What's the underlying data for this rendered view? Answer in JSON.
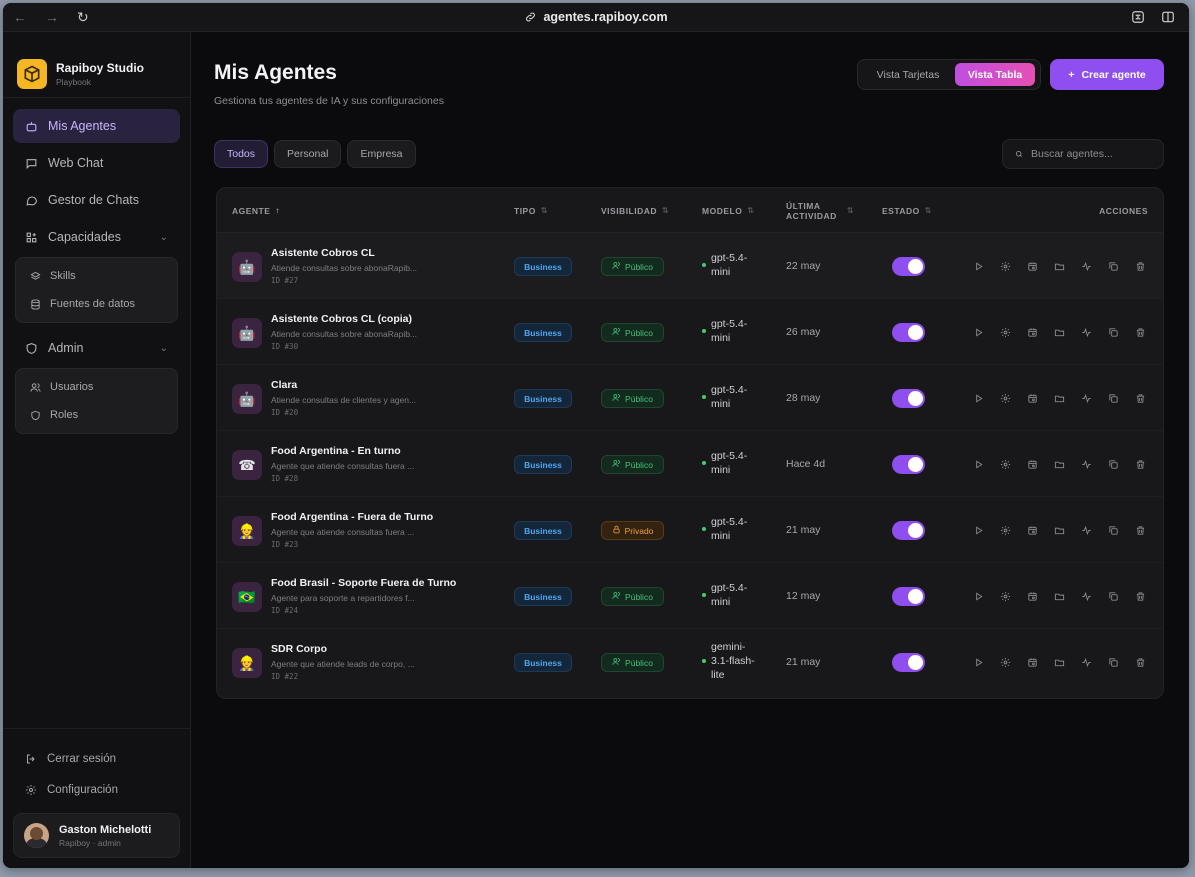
{
  "browser": {
    "url": "agentes.rapiboy.com"
  },
  "brand": {
    "name": "Rapiboy Studio",
    "subtitle": "Playbook"
  },
  "sidebar": {
    "items": [
      {
        "label": "Mis Agentes",
        "icon": "bot-icon",
        "active": true
      },
      {
        "label": "Web Chat",
        "icon": "message-square-icon"
      },
      {
        "label": "Gestor de Chats",
        "icon": "message-circle-icon"
      },
      {
        "label": "Capacidades",
        "icon": "grid-plus-icon",
        "sub": [
          {
            "label": "Skills",
            "icon": "layers-icon"
          },
          {
            "label": "Fuentes de datos",
            "icon": "database-icon"
          }
        ]
      },
      {
        "label": "Admin",
        "icon": "shield-icon",
        "sub": [
          {
            "label": "Usuarios",
            "icon": "users-icon"
          },
          {
            "label": "Roles",
            "icon": "shield-icon"
          }
        ]
      }
    ],
    "bottom": [
      {
        "label": "Cerrar sesión",
        "icon": "logout-icon"
      },
      {
        "label": "Configuración",
        "icon": "gear-icon"
      }
    ],
    "user": {
      "name": "Gaston Michelotti",
      "role": "Rapiboy · admin"
    }
  },
  "header": {
    "title": "Mis Agentes",
    "subtitle": "Gestiona tus agentes de IA y sus configuraciones",
    "view_cards": "Vista Tarjetas",
    "view_table": "Vista Tabla",
    "create": "Crear agente"
  },
  "filters": {
    "items": [
      "Todos",
      "Personal",
      "Empresa"
    ],
    "active": "Todos"
  },
  "search": {
    "placeholder": "Buscar agentes..."
  },
  "table": {
    "columns": {
      "agent": "Agente",
      "type": "Tipo",
      "visibility": "Visibilidad",
      "model": "Modelo",
      "activity": "Última actividad",
      "status": "Estado",
      "actions": "Acciones"
    },
    "rows": [
      {
        "icon": "🤖",
        "name": "Asistente Cobros CL",
        "desc": "Atiende consultas sobre abonaRapib...",
        "id": "ID #27",
        "type": "Business",
        "visibility": "Público",
        "private": false,
        "model": "gpt-5.4-mini",
        "activity": "22 may",
        "enabled": true
      },
      {
        "icon": "🤖",
        "name": "Asistente Cobros CL (copia)",
        "desc": "Atiende consultas sobre abonaRapib...",
        "id": "ID #30",
        "type": "Business",
        "visibility": "Público",
        "private": false,
        "model": "gpt-5.4-mini",
        "activity": "26 may",
        "enabled": true
      },
      {
        "icon": "🤖",
        "name": "Clara",
        "desc": "Atiende consultas de clientes y agen...",
        "id": "ID #20",
        "type": "Business",
        "visibility": "Público",
        "private": false,
        "model": "gpt-5.4-mini",
        "activity": "28 may",
        "enabled": true
      },
      {
        "icon": "☎",
        "name": "Food Argentina - En turno",
        "desc": "Agente que atiende consultas fuera ...",
        "id": "ID #28",
        "type": "Business",
        "visibility": "Público",
        "private": false,
        "model": "gpt-5.4-mini",
        "activity": "Hace 4d",
        "enabled": true
      },
      {
        "icon": "👷",
        "name": "Food Argentina - Fuera de Turno",
        "desc": "Agente que atiende consultas fuera ...",
        "id": "ID #23",
        "type": "Business",
        "visibility": "Privado",
        "private": true,
        "model": "gpt-5.4-mini",
        "activity": "21 may",
        "enabled": true
      },
      {
        "icon": "🇧🇷",
        "name": "Food Brasil - Soporte Fuera de Turno",
        "desc": "Agente para soporte a repartidores f...",
        "id": "ID #24",
        "type": "Business",
        "visibility": "Público",
        "private": false,
        "model": "gpt-5.4-mini",
        "activity": "12 may",
        "enabled": true
      },
      {
        "icon": "👷",
        "name": "SDR Corpo",
        "desc": "Agente que atiende leads de corpo, ...",
        "id": "ID #22",
        "type": "Business",
        "visibility": "Público",
        "private": false,
        "model": "gemini-3.1-flash-lite",
        "activity": "21 may",
        "enabled": true
      }
    ],
    "row_actions": [
      "play-icon",
      "gear-icon",
      "calendar-icon",
      "folder-icon",
      "activity-icon",
      "copy-icon",
      "trash-icon"
    ]
  },
  "colors": {
    "accent": "#8f4ef0",
    "active_tab": "#c14ee0",
    "type_badge": "#52a6ec",
    "public": "#46c27a",
    "private": "#f0a33c"
  }
}
